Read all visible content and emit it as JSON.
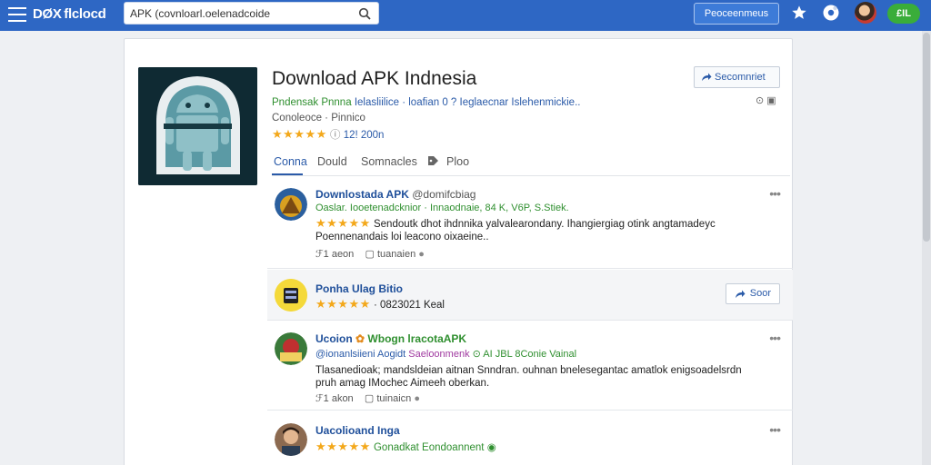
{
  "header": {
    "logo": "DØX flclocd",
    "search_value": "APK (covnloarl.oelenadcoide",
    "search_placeholder": "Search",
    "primary_button": "Peoceenmeus",
    "badge": "£IL"
  },
  "app": {
    "title": "Download APK Indnesia",
    "subscribe_label": "Secomnriet",
    "tagline_green": "Pndensak Pnnna",
    "tagline_blue": "Ielasliilice · loafian 0 ? Ieglaecnar Islehenmickie..",
    "developer": "Conoleoce · Pinnico",
    "rating_stars": "★★★★★",
    "rating_text": "12! 200n",
    "mini_icons": "⊙ ▣",
    "tabs": [
      {
        "label": "Conna"
      },
      {
        "label": "Dould"
      },
      {
        "label": "Somnacles"
      },
      {
        "label": "Ploo"
      }
    ]
  },
  "feed": [
    {
      "name": "Downlostada APK",
      "handle": "@domifcbiag",
      "green": "Oaslar. Iooetenadcknior · Innaodnaie, 84 K, V6P, S.Stiek.",
      "stars": "★★★★★",
      "text": "Sendoutk dhot ihdnnika yalvalearondany. Ihangiergiag otink angtamadeyc Poennenandais loi leacono oixaeine..",
      "action_1": "ℱ1 aeon",
      "action_2": "▢ tuanaien",
      "dots": "•••"
    },
    {
      "name": "Ponha Ulag Bitio",
      "stars": "★★★★★",
      "meta": "· 0823021 Keal",
      "see_label": "Soor"
    },
    {
      "name": "Ucoion",
      "name_green": "Wbogn lracotaAPK",
      "meta_blue": "@ionanlsiieni Aogidt",
      "meta_purple": "Saeloonmenk",
      "meta_green": "⊙ AI JBL 8Conie Vainal",
      "text": "Tlasanedioak; mandsldeian aitnan Snndran. ouhnan bnelesegantac amatlok enigsoadelsrdn pruh amag IMochec Aimeeh oberkan.",
      "action_1": "ℱ1 akon",
      "action_2": "▢ tuinaicn",
      "dots": "•••"
    },
    {
      "name": "Uacolioand Inga",
      "stars": "★★★★★",
      "green": "Gonadkat Eondoannent",
      "dots": "•••"
    }
  ],
  "colors": {
    "topbar": "#2e67c4",
    "link_blue": "#2a5aa8",
    "green": "#2f8f2f",
    "star": "#f3a81b"
  }
}
